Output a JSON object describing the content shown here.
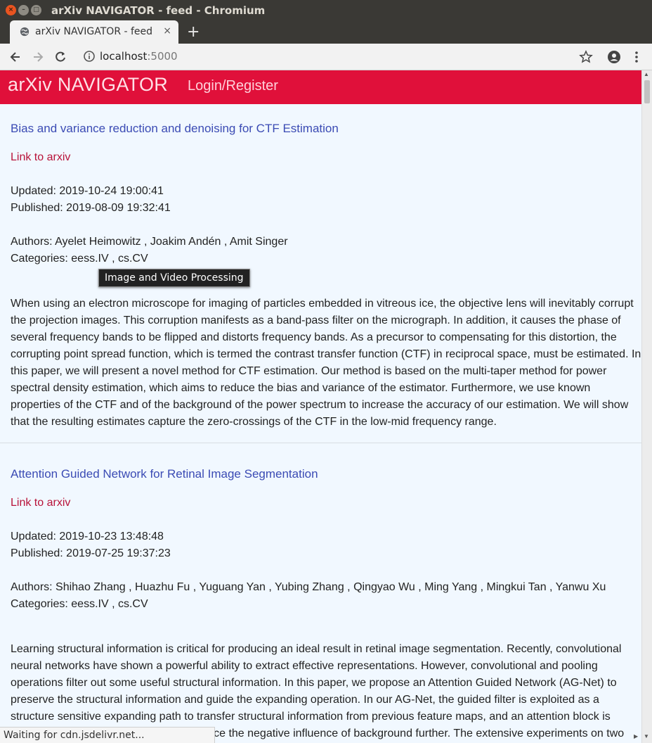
{
  "window": {
    "title": "arXiv NAVIGATOR - feed - Chromium",
    "close_glyph": "×",
    "min_glyph": "–",
    "max_glyph": "□"
  },
  "tab": {
    "title": "arXiv NAVIGATOR - feed",
    "close_glyph": "×",
    "new_tab_glyph": "+"
  },
  "address_bar": {
    "host": "localhost",
    "port": ":5000"
  },
  "header": {
    "brand": "arXiv NAVIGATOR",
    "login": "Login/Register"
  },
  "papers": [
    {
      "title": "Bias and variance reduction and denoising for CTF Estimation",
      "link": "Link to arxiv",
      "updated": "Updated: 2019-10-24 19:00:41",
      "published": "Published: 2019-08-09 19:32:41",
      "authors": "Authors: Ayelet Heimowitz , Joakim Andén , Amit Singer",
      "categories": "Categories: eess.IV , cs.CV",
      "abstract": "When using an electron microscope for imaging of particles embedded in vitreous ice, the objective lens will inevitably corrupt the projection images. This corruption manifests as a band-pass filter on the micrograph. In addition, it causes the phase of several frequency bands to be flipped and distorts frequency bands. As a precursor to compensating for this distortion, the corrupting point spread function, which is termed the contrast transfer function (CTF) in reciprocal space, must be estimated. In this paper, we will present a novel method for CTF estimation. Our method is based on the multi-taper method for power spectral density estimation, which aims to reduce the bias and variance of the estimator. Furthermore, we use known properties of the CTF and of the background of the power spectrum to increase the accuracy of our estimation. We will show that the resulting estimates capture the zero-crossings of the CTF in the low-mid frequency range."
    },
    {
      "title": "Attention Guided Network for Retinal Image Segmentation",
      "link": "Link to arxiv",
      "updated": "Updated: 2019-10-23 13:48:48",
      "published": "Published: 2019-07-25 19:37:23",
      "authors": "Authors: Shihao Zhang , Huazhu Fu , Yuguang Yan , Yubing Zhang , Qingyao Wu , Ming Yang , Mingkui Tan , Yanwu Xu",
      "categories": "Categories: eess.IV , cs.CV",
      "abstract": "Learning structural information is critical for producing an ideal result in retinal image segmentation. Recently, convolutional neural networks have shown a powerful ability to extract effective representations. However, convolutional and pooling operations filter out some useful structural information. In this paper, we propose an Attention Guided Network (AG-Net) to preserve the structural information and guide the expanding operation. In our AG-Net, the guided filter is exploited as a structure sensitive expanding path to transfer structural information from previous feature maps, and an attention block is introduced to exclude the noise and reduce the negative influence of background further. The extensive experiments on two"
    }
  ],
  "tooltip": "Image and Video Processing",
  "status_text": "Waiting for cdn.jsdelivr.net...",
  "colors": {
    "header_bg": "#e0103a",
    "content_bg": "#f1f8ff",
    "title_link": "#3b4bb4",
    "arxiv_link": "#b8133a"
  }
}
